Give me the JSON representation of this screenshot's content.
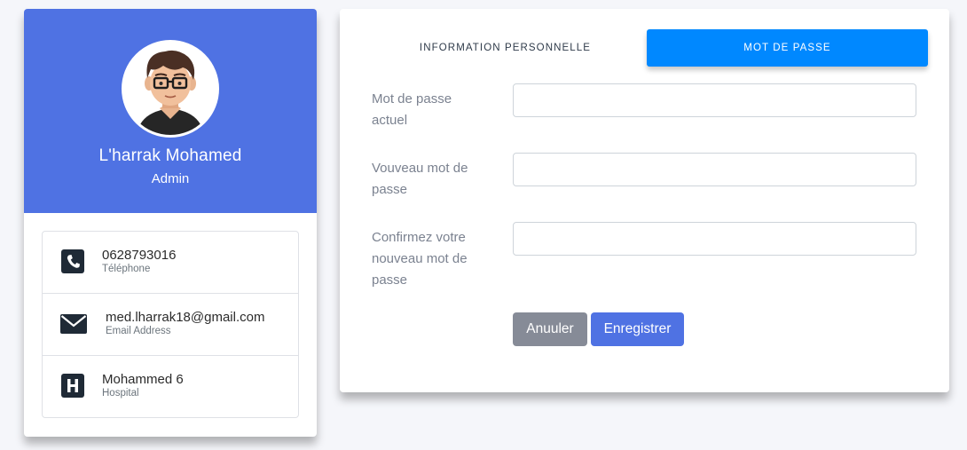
{
  "profile": {
    "name": "L'harrak Mohamed",
    "role": "Admin",
    "info": [
      {
        "icon": "phone-icon",
        "value": "0628793016",
        "label": "Téléphone"
      },
      {
        "icon": "envelope-icon",
        "value": "med.lharrak18@gmail.com",
        "label": "Email Address"
      },
      {
        "icon": "hospital-icon",
        "value": "Mohammed 6",
        "label": "Hospital"
      }
    ]
  },
  "tabs": [
    {
      "label": "INFORMATION PERSONNELLE",
      "active": false
    },
    {
      "label": "MOT DE PASSE",
      "active": true
    }
  ],
  "form": {
    "fields": [
      {
        "label_lines": [
          "Mot de passe",
          "actuel"
        ],
        "value": ""
      },
      {
        "label_lines": [
          "Vouveau mot de",
          "passe"
        ],
        "value": ""
      },
      {
        "label_lines": [
          "Confirmez votre",
          "nouveau mot de",
          "passe"
        ],
        "value": ""
      }
    ],
    "cancel_label": "Anuuler",
    "save_label": "Enregistrer"
  },
  "colors": {
    "header_blue": "#4f72e3",
    "tab_active": "#0088ff",
    "cancel_gray": "#868b97",
    "save_blue": "#4f72e3",
    "page_bg": "#f5f6fa"
  }
}
